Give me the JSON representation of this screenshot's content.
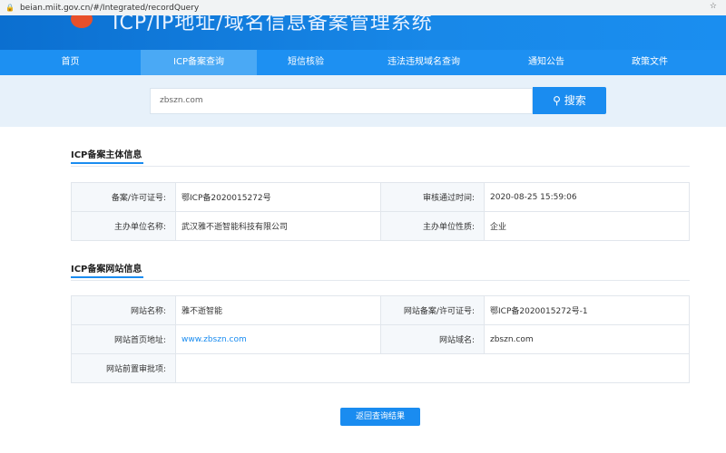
{
  "browser": {
    "url": "beian.miit.gov.cn/#/Integrated/recordQuery"
  },
  "header": {
    "title": "ICP/IP地址/域名信息备案管理系统"
  },
  "nav": [
    "首页",
    "ICP备案查询",
    "短信核验",
    "违法违规域名查询",
    "通知公告",
    "政策文件"
  ],
  "search": {
    "value": "zbszn.com",
    "button": "搜索"
  },
  "subject": {
    "title": "ICP备案主体信息",
    "rows": [
      [
        "备案/许可证号:",
        "鄂ICP备2020015272号",
        "审核通过时间:",
        "2020-08-25 15:59:06"
      ],
      [
        "主办单位名称:",
        "武汉雅不逝智能科技有限公司",
        "主办单位性质:",
        "企业"
      ]
    ]
  },
  "site": {
    "title": "ICP备案网站信息",
    "name_label": "网站名称:",
    "name": "雅不逝智能",
    "lic_label": "网站备案/许可证号:",
    "lic": "鄂ICP备2020015272号-1",
    "home_label": "网站首页地址:",
    "home": "www.zbszn.com",
    "domain_label": "网站域名:",
    "domain": "zbszn.com",
    "pre_label": "网站前置审批项:"
  },
  "back_button": "返回查询结果"
}
